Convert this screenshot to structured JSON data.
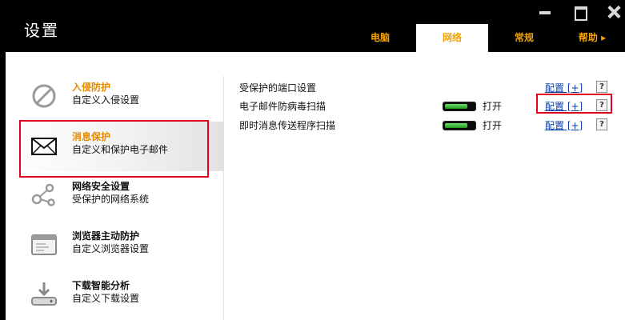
{
  "window": {
    "title": "设置"
  },
  "tabs": [
    {
      "label": "电脑",
      "active": false
    },
    {
      "label": "网络",
      "active": true
    },
    {
      "label": "常规",
      "active": false
    },
    {
      "label": "帮助 ▸",
      "active": false
    }
  ],
  "sidebar": {
    "items": [
      {
        "title": "入侵防护",
        "subtitle": "自定义入侵设置",
        "icon": "block-icon",
        "selected": false
      },
      {
        "title": "消息保护",
        "subtitle": "自定义和保护电子邮件",
        "icon": "envelope-icon",
        "selected": true
      },
      {
        "title": "网络安全设置",
        "subtitle": "受保护的网络系统",
        "icon": "network-nodes-icon",
        "selected": false
      },
      {
        "title": "浏览器主动防护",
        "subtitle": "自定义浏览器设置",
        "icon": "browser-window-icon",
        "selected": false
      },
      {
        "title": "下载智能分析",
        "subtitle": "自定义下载设置",
        "icon": "download-icon",
        "selected": false
      }
    ]
  },
  "settings": {
    "rows": [
      {
        "label": "受保护的端口设置",
        "config": "配置 [+]",
        "help": "?"
      },
      {
        "label": "电子邮件防病毒扫描",
        "toggle_text": "打开",
        "toggle_on": true,
        "config": "配置 [+]",
        "help": "?"
      },
      {
        "label": "即时消息传送程序扫描",
        "toggle_text": "打开",
        "toggle_on": true,
        "config": "配置 [+]",
        "help": "?"
      }
    ]
  },
  "colors": {
    "accent": "#f4a300",
    "highlight": "#e0001b",
    "link": "#0a3ea8",
    "toggle_on": "#2fb52f"
  }
}
